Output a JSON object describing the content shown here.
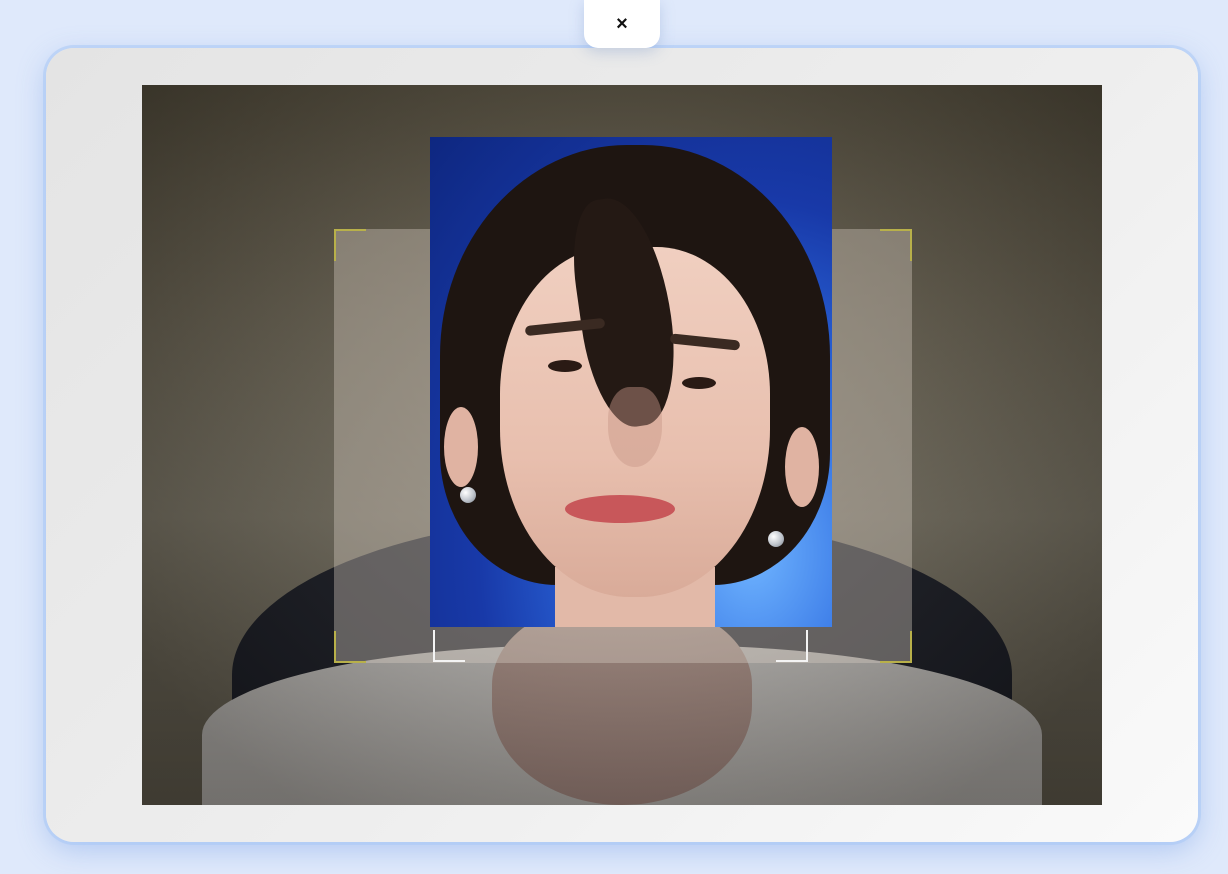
{
  "close_button": {
    "icon": "close-icon",
    "glyph": "×"
  },
  "colors": {
    "page_background": "#dfe9fb",
    "card_background": "#eeeeee",
    "guide_corner": "#b8b04a",
    "inner_corner": "#f4f4f4",
    "portrait_background": "#1839a8"
  },
  "camera": {
    "feed": "camera-preview",
    "face_guide": "face-alignment-frame"
  },
  "reference_photo": {
    "subject": "face-reference-portrait"
  }
}
